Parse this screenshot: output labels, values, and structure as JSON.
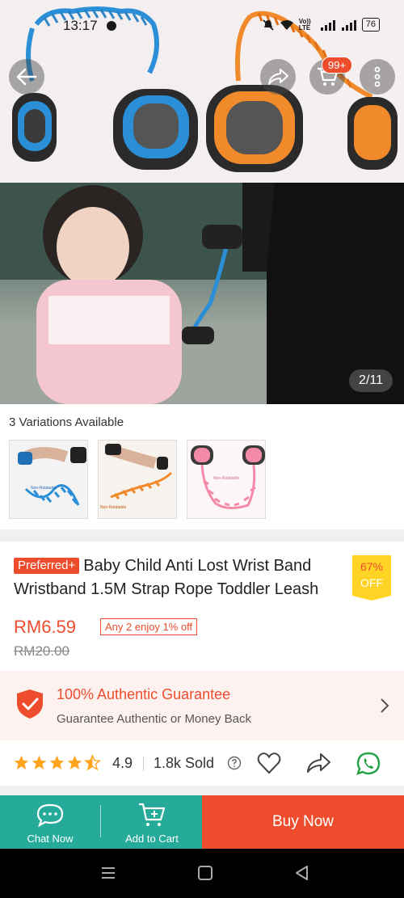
{
  "status_bar": {
    "time": "13:17",
    "network_label": "Vo)) LTE",
    "battery": "76"
  },
  "hero": {
    "cart_badge": "99+",
    "image_counter": "2/11",
    "icons": [
      "back-arrow-icon",
      "share-icon",
      "cart-icon",
      "more-vertical-icon"
    ]
  },
  "variations": {
    "title": "3 Variations Available",
    "items": [
      {
        "label": "Non-Rotatable",
        "color": "#2a8fd6"
      },
      {
        "label": "Non-Rotatable",
        "color": "#f08a2a"
      },
      {
        "label": "Non-Rotatable",
        "color": "#f48aa8"
      }
    ]
  },
  "product": {
    "badge": "Preferred+",
    "title": "Baby Child Anti Lost Wrist Band Wristband 1.5M Strap Rope Toddler Leash",
    "discount_percent": "67%",
    "discount_off": "OFF",
    "price": "RM6.59",
    "promo": "Any 2 enjoy 1% off",
    "original_price": "RM20.00"
  },
  "guarantee": {
    "title": "100% Authentic Guarantee",
    "subtitle": "Guarantee Authentic or Money Back"
  },
  "rating": {
    "value": "4.9",
    "stars": 4.5,
    "sold": "1.8k Sold"
  },
  "actions": {
    "chat": "Chat Now",
    "add_to_cart": "Add to Cart",
    "buy_now": "Buy Now"
  },
  "colors": {
    "brand": "#ee4d2d",
    "teal": "#26aa99",
    "star": "#ffa41c",
    "whatsapp": "#25a244"
  }
}
